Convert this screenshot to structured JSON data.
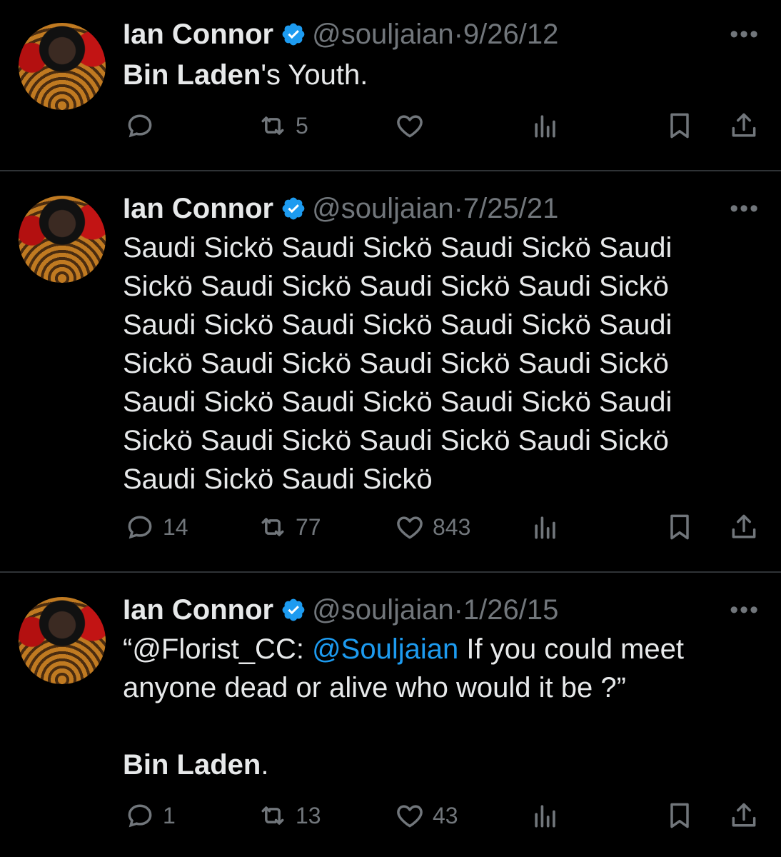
{
  "tweets": [
    {
      "name": "Ian Connor",
      "handle": "@souljaian",
      "separator": "·",
      "date": "9/26/12",
      "body_bold": "Bin Laden",
      "body_rest": "'s Youth.",
      "replies": "",
      "retweets": "5",
      "likes": ""
    },
    {
      "name": "Ian Connor",
      "handle": "@souljaian",
      "separator": "·",
      "date": "7/25/21",
      "body_lines": [
        "Saudi Sickö Saudi Sickö Saudi Sickö Saudi",
        "Sickö Saudi Sickö Saudi Sickö Saudi Sickö",
        "Saudi Sickö Saudi Sickö Saudi Sickö Saudi",
        "Sickö Saudi Sickö Saudi Sickö Saudi Sickö",
        "Saudi Sickö Saudi Sickö Saudi Sickö Saudi",
        "Sickö Saudi Sickö Saudi Sickö Saudi Sickö",
        "Saudi Sickö Saudi Sickö"
      ],
      "replies": "14",
      "retweets": "77",
      "likes": "843"
    },
    {
      "name": "Ian Connor",
      "handle": "@souljaian",
      "separator": "·",
      "date": "1/26/15",
      "quote_prefix": "“@Florist_CC: ",
      "mention": "@Souljaian",
      "quote_rest_1": " If you could meet",
      "quote_rest_2": "anyone dead or alive who would it be ?”",
      "answer_bold": "Bin Laden",
      "answer_rest": ".",
      "replies": "1",
      "retweets": "13",
      "likes": "43"
    }
  ],
  "icons": {
    "reply": "reply-icon",
    "retweet": "retweet-icon",
    "like": "heart-icon",
    "views": "views-icon",
    "bookmark": "bookmark-icon",
    "share": "share-icon",
    "verified": "verified-badge-icon",
    "more": "more-icon"
  },
  "colors": {
    "background": "#000000",
    "text": "#e7e9ea",
    "muted": "#71767b",
    "link": "#1d9bf0",
    "divider": "#2f3336"
  }
}
